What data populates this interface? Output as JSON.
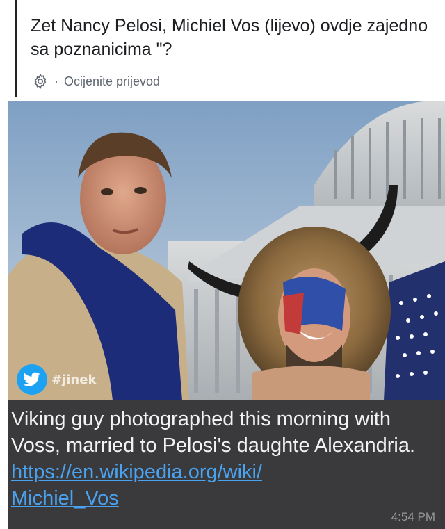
{
  "post": {
    "text": "Zet Nancy Pelosi, Michiel Vos (lijevo) ovdje zajedno sa poznanicima \"?",
    "translate_dot": "·",
    "translate_label": "Ocijenite prijevod"
  },
  "shared_screenshot": {
    "photo": {
      "description_icon": "photo",
      "watermark_handle": "#jinek",
      "watermark_icon": "twitter-bird-icon"
    },
    "caption": {
      "text": "Viking guy photographed this morning with Voss, married to Pelosi's daughte Alexandria.",
      "link_line1": "https://en.wikipedia.org/wiki/",
      "link_line2": "Michiel_Vos",
      "timestamp": "4:54 PM"
    }
  },
  "colors": {
    "link": "#4aa3f0",
    "caption_bg": "#3a3a3c",
    "twitter_blue": "#1da1f2"
  }
}
